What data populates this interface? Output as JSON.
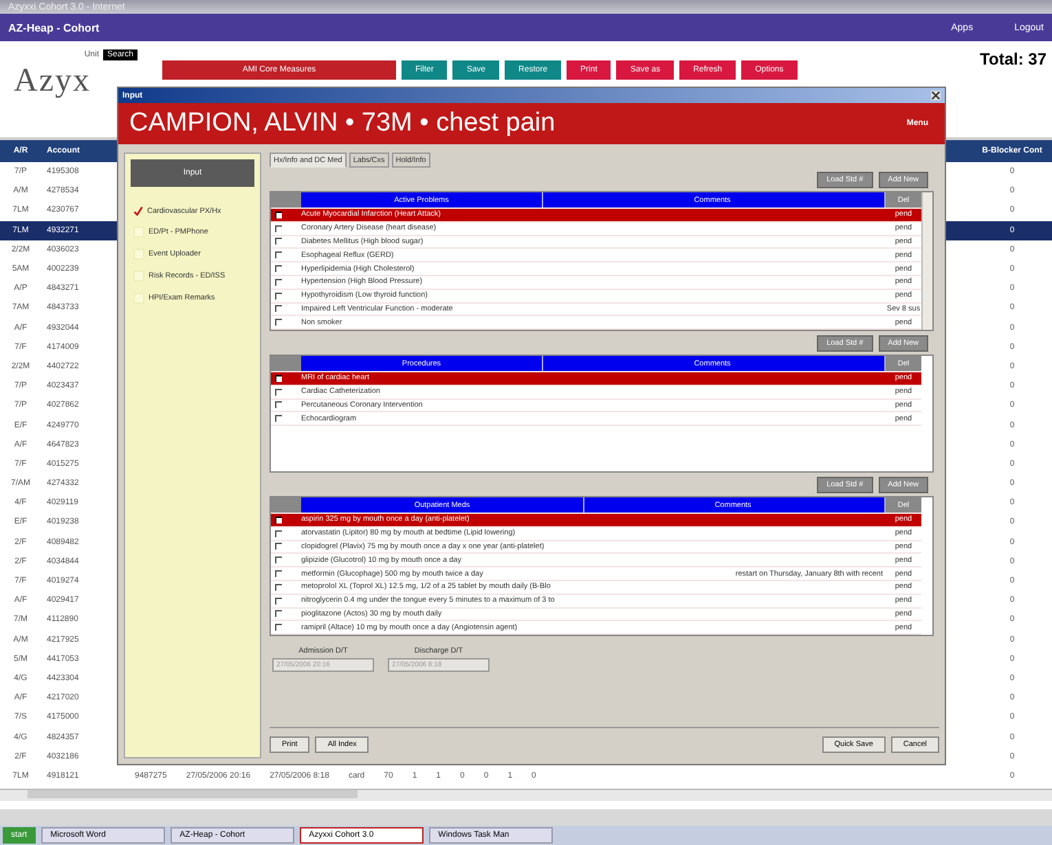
{
  "window": {
    "title": "Azyxxi Cohort 3.0 - Internet"
  },
  "app_bar": {
    "title": "AZ-Heap - Cohort",
    "links": [
      "Apps",
      "Logout"
    ]
  },
  "header": {
    "logo": "Azyx",
    "unit_label": "Unit",
    "unit_button": "Search",
    "total": "Total: 37",
    "tabs": [
      {
        "label": "AMI Core Measures",
        "kind": "wide"
      },
      {
        "label": "Filter",
        "kind": "teal"
      },
      {
        "label": "Save",
        "kind": "teal"
      },
      {
        "label": "Restore",
        "kind": "teal"
      },
      {
        "label": "Print",
        "kind": "red"
      },
      {
        "label": "Save as",
        "kind": "red"
      },
      {
        "label": "Refresh",
        "kind": "red"
      },
      {
        "label": "Options",
        "kind": "red"
      }
    ]
  },
  "table": {
    "columns": [
      "A/R",
      "Account",
      "B-Blocker Cont"
    ],
    "rows": [
      {
        "a_r": "7/P",
        "account": "4195308",
        "b_blocker": "0",
        "selected": false
      },
      {
        "a_r": "A/M",
        "account": "4278534",
        "b_blocker": "0",
        "selected": false
      },
      {
        "a_r": "7LM",
        "account": "4230767",
        "b_blocker": "0",
        "selected": false
      },
      {
        "a_r": "7LM",
        "account": "4932271",
        "b_blocker": "0",
        "selected": true
      },
      {
        "a_r": "2/2M",
        "account": "4036023",
        "b_blocker": "0",
        "selected": false
      },
      {
        "a_r": "5AM",
        "account": "4002239",
        "b_blocker": "0",
        "selected": false
      },
      {
        "a_r": "A/P",
        "account": "4843271",
        "b_blocker": "0",
        "selected": false
      },
      {
        "a_r": "7AM",
        "account": "4843733",
        "b_blocker": "0",
        "selected": false
      },
      {
        "a_r": "A/F",
        "account": "4932044",
        "b_blocker": "0",
        "selected": false
      },
      {
        "a_r": "7/F",
        "account": "4174009",
        "b_blocker": "0",
        "selected": false
      },
      {
        "a_r": "2/2M",
        "account": "4402722",
        "b_blocker": "0",
        "selected": false
      },
      {
        "a_r": "7/P",
        "account": "4023437",
        "b_blocker": "0",
        "selected": false
      },
      {
        "a_r": "7/P",
        "account": "4027862",
        "b_blocker": "0",
        "selected": false
      },
      {
        "a_r": "E/F",
        "account": "4249770",
        "b_blocker": "0",
        "selected": false
      },
      {
        "a_r": "A/F",
        "account": "4647823",
        "b_blocker": "0",
        "selected": false
      },
      {
        "a_r": "7/F",
        "account": "4015275",
        "b_blocker": "0",
        "selected": false
      },
      {
        "a_r": "7/AM",
        "account": "4274332",
        "b_blocker": "0",
        "selected": false
      },
      {
        "a_r": "4/F",
        "account": "4029119",
        "b_blocker": "0",
        "selected": false
      },
      {
        "a_r": "E/F",
        "account": "4019238",
        "b_blocker": "0",
        "selected": false
      },
      {
        "a_r": "2/F",
        "account": "4089482",
        "b_blocker": "0",
        "selected": false
      },
      {
        "a_r": "2/F",
        "account": "4034844",
        "b_blocker": "0",
        "selected": false
      },
      {
        "a_r": "7/F",
        "account": "4019274",
        "b_blocker": "0",
        "selected": false
      },
      {
        "a_r": "A/F",
        "account": "4029417",
        "b_blocker": "0",
        "selected": false
      },
      {
        "a_r": "7/M",
        "account": "4112890",
        "b_blocker": "0",
        "selected": false
      },
      {
        "a_r": "A/M",
        "account": "4217925",
        "b_blocker": "0",
        "selected": false
      },
      {
        "a_r": "5/M",
        "account": "4417053",
        "b_blocker": "0",
        "selected": false
      },
      {
        "a_r": "4/G",
        "account": "4423304",
        "b_blocker": "0",
        "selected": false
      },
      {
        "a_r": "A/F",
        "account": "4217020",
        "b_blocker": "0",
        "selected": false
      },
      {
        "a_r": "7/S",
        "account": "4175000",
        "b_blocker": "0",
        "selected": false
      },
      {
        "a_r": "4/G",
        "account": "4824357",
        "b_blocker": "0",
        "selected": false
      },
      {
        "a_r": "2/F",
        "account": "4032186",
        "b_blocker": "0",
        "selected": false
      }
    ],
    "last_row": {
      "a_r": "7LM",
      "account": "4918121",
      "cells": [
        "9487275",
        "27/05/2006 20:16",
        "27/05/2006 8:18",
        "card",
        "70",
        "1",
        "1",
        "0",
        "0",
        "1",
        "0"
      ],
      "b_blocker": "0"
    }
  },
  "dialog": {
    "title": "Input",
    "patient": "CAMPION, ALVIN • 73M • chest pain",
    "menu": "Menu",
    "side_header": "Input",
    "side_items": [
      {
        "label": "Cardiovascular PX/Hx",
        "checked": true
      },
      {
        "label": "ED/Pt - PMPhone",
        "checked": false
      },
      {
        "label": "Event Uploader",
        "checked": false
      },
      {
        "label": "Risk Records - ED/ISS",
        "checked": false
      },
      {
        "label": "HPI/Exam Remarks",
        "checked": false
      }
    ],
    "tabs": [
      {
        "label": "Hx/Info and DC Med",
        "selected": true
      },
      {
        "label": "Labs/Cxs",
        "selected": false
      },
      {
        "label": "Hold/Info",
        "selected": false
      }
    ],
    "sections": [
      {
        "buttons": [
          "Load Std #",
          "Add New"
        ],
        "columns": [
          "Active Problems",
          "Comments",
          "Del"
        ],
        "scroll": true,
        "rows": [
          {
            "text": "Acute Myocardial Infarction (Heart Attack)",
            "comment": "",
            "status": "pend",
            "checked": true,
            "selected": true
          },
          {
            "text": "Coronary Artery Disease (heart disease)",
            "comment": "",
            "status": "pend",
            "checked": false,
            "selected": false
          },
          {
            "text": "Diabetes Mellitus (High blood sugar)",
            "comment": "",
            "status": "pend",
            "checked": false,
            "selected": false
          },
          {
            "text": "Esophageal Reflux (GERD)",
            "comment": "",
            "status": "pend",
            "checked": false,
            "selected": false
          },
          {
            "text": "Hyperlipidemia (High Cholesterol)",
            "comment": "",
            "status": "pend",
            "checked": false,
            "selected": false
          },
          {
            "text": "Hypertension (High Blood Pressure)",
            "comment": "",
            "status": "pend",
            "checked": false,
            "selected": false
          },
          {
            "text": "Hypothyroidism (Low thyroid function)",
            "comment": "",
            "status": "pend",
            "checked": false,
            "selected": false
          },
          {
            "text": "Impaired Left Ventricular Function - moderate",
            "comment": "",
            "status": "Sev 8 sus",
            "checked": false,
            "selected": false
          },
          {
            "text": "Non smoker",
            "comment": "",
            "status": "pend",
            "checked": false,
            "selected": false
          }
        ]
      },
      {
        "buttons": [
          "Load Std #",
          "Add New"
        ],
        "columns": [
          "Procedures",
          "Comments",
          "Del"
        ],
        "scroll": false,
        "rows": [
          {
            "text": "MRI of cardiac heart",
            "comment": "",
            "status": "pend",
            "checked": true,
            "selected": true
          },
          {
            "text": "Cardiac Catheterization",
            "comment": "",
            "status": "pend",
            "checked": false,
            "selected": false
          },
          {
            "text": "Percutaneous Coronary Intervention",
            "comment": "",
            "status": "pend",
            "checked": false,
            "selected": false
          },
          {
            "text": "Echocardiogram",
            "comment": "",
            "status": "pend",
            "checked": false,
            "selected": false
          }
        ]
      },
      {
        "buttons": [
          "Load Std #",
          "Add New"
        ],
        "columns": [
          "Outpatient Meds",
          "Comments",
          "Del"
        ],
        "scroll": false,
        "rows": [
          {
            "text": "aspirin 325 mg by mouth once a day (anti-platelet)",
            "comment": "",
            "status": "pend",
            "checked": true,
            "selected": true
          },
          {
            "text": "atorvastatin (Lipitor) 80 mg by mouth at bedtime (Lipid lowering)",
            "comment": "",
            "status": "pend",
            "checked": false,
            "selected": false
          },
          {
            "text": "clopidogrel (Plavix) 75 mg by mouth once a day x one year (anti-platelet)",
            "comment": "",
            "status": "pend",
            "checked": false,
            "selected": false
          },
          {
            "text": "glipizide (Glucotrol) 10 mg by mouth once a day",
            "comment": "",
            "status": "pend",
            "checked": false,
            "selected": false
          },
          {
            "text": "metformin (Glucophage) 500 mg by mouth twice a day",
            "comment": "restart on Thursday, January 8th with recent",
            "status": "pend",
            "checked": false,
            "selected": false
          },
          {
            "text": "metoprolol XL (Toprol XL) 12.5 mg, 1/2 of a 25 tablet by mouth daily (B-Blo",
            "comment": "",
            "status": "pend",
            "checked": false,
            "selected": false
          },
          {
            "text": "nitroglycerin 0.4 mg under the tongue every 5 minutes to a maximum of 3 to",
            "comment": "",
            "status": "pend",
            "checked": false,
            "selected": false
          },
          {
            "text": "pioglitazone (Actos) 30 mg by mouth daily",
            "comment": "",
            "status": "pend",
            "checked": false,
            "selected": false
          },
          {
            "text": "ramipril (Altace) 10 mg by mouth once a day (Angiotensin agent)",
            "comment": "",
            "status": "pend",
            "checked": false,
            "selected": false
          }
        ]
      }
    ],
    "dates": [
      {
        "label": "Admission D/T",
        "value": "27/05/2006 20:16"
      },
      {
        "label": "Discharge D/T",
        "value": "27/05/2006 8:18"
      }
    ],
    "left_buttons": [
      "Print",
      "All Index"
    ],
    "right_buttons": [
      "Quick Save",
      "Cancel"
    ]
  },
  "taskbar": {
    "start": "start",
    "tasks": [
      {
        "label": "Microsoft Word",
        "selected": false
      },
      {
        "label": "AZ-Heap - Cohort",
        "selected": false
      },
      {
        "label": "Azyxxi Cohort 3.0",
        "selected": true
      },
      {
        "label": "Windows Task Man",
        "selected": false
      }
    ]
  }
}
